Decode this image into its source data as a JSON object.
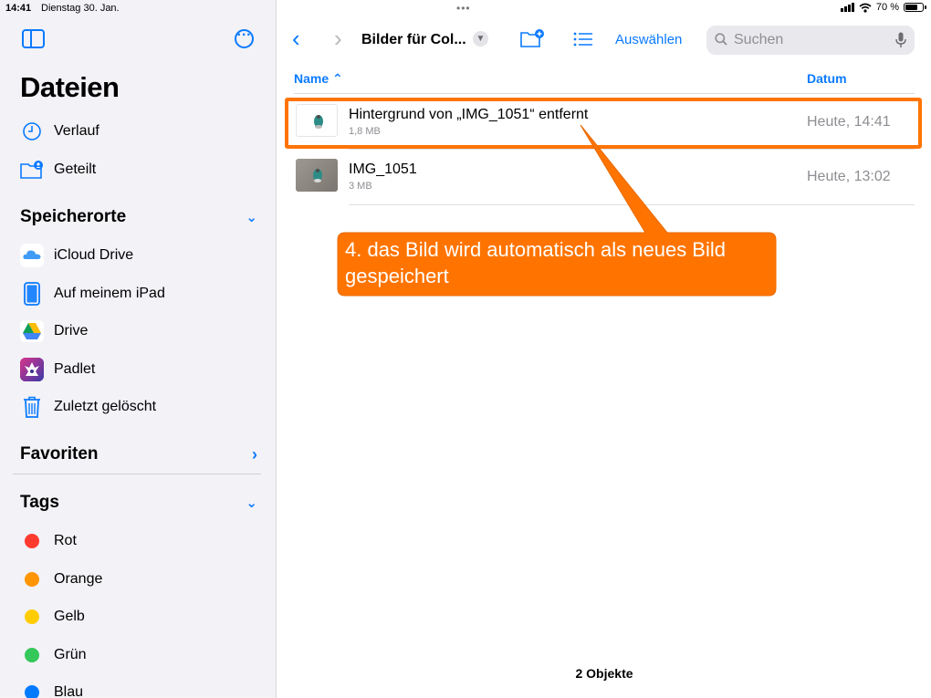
{
  "status": {
    "time": "14:41",
    "date": "Dienstag 30. Jan.",
    "battery": "70 %",
    "battery_level": 0.7
  },
  "sidebar": {
    "title": "Dateien",
    "items_top": [
      {
        "label": "Verlauf",
        "icon": "clock-icon"
      },
      {
        "label": "Geteilt",
        "icon": "shared-folder-icon"
      }
    ],
    "section_locations": "Speicherorte",
    "locations": [
      {
        "label": "iCloud Drive",
        "icon": "icloud-icon"
      },
      {
        "label": "Auf meinem iPad",
        "icon": "ipad-icon"
      },
      {
        "label": "Drive",
        "icon": "google-drive-icon"
      },
      {
        "label": "Padlet",
        "icon": "padlet-icon"
      },
      {
        "label": "Zuletzt gelöscht",
        "icon": "trash-icon"
      }
    ],
    "section_favorites": "Favoriten",
    "section_tags": "Tags",
    "tags": [
      {
        "label": "Rot",
        "color": "#ff3b30"
      },
      {
        "label": "Orange",
        "color": "#ff9500"
      },
      {
        "label": "Gelb",
        "color": "#ffcc00"
      },
      {
        "label": "Grün",
        "color": "#34c759"
      },
      {
        "label": "Blau",
        "color": "#007aff"
      }
    ]
  },
  "toolbar": {
    "folder_title": "Bilder für Col...",
    "select_label": "Auswählen",
    "search_placeholder": "Suchen"
  },
  "columns": {
    "name": "Name",
    "date": "Datum"
  },
  "files": [
    {
      "name": "Hintergrund von „IMG_1051“ entfernt",
      "size": "1,8 MB",
      "date": "Heute, 14:41"
    },
    {
      "name": "IMG_1051",
      "size": "3 MB",
      "date": "Heute, 13:02"
    }
  ],
  "callout": {
    "text": "4. das Bild wird automatisch als neues Bild gespeichert",
    "color": "#ff7400"
  },
  "footer": "2 Objekte"
}
